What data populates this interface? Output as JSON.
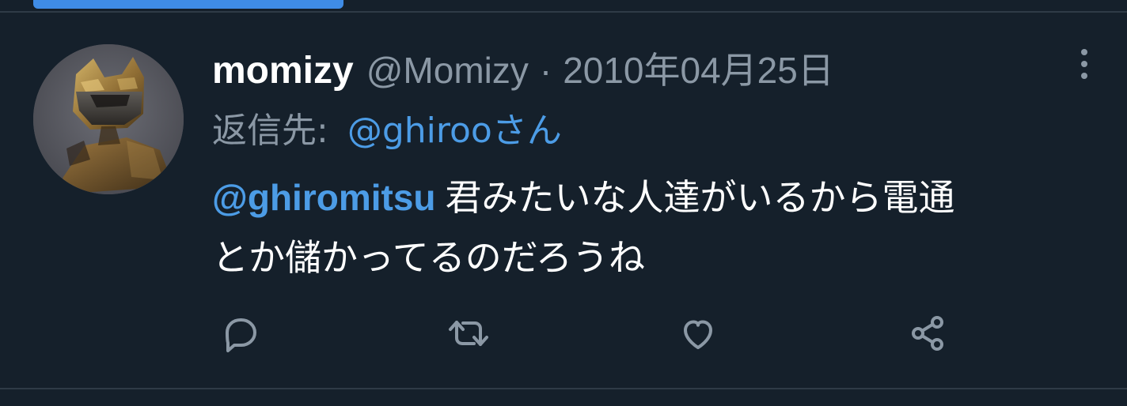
{
  "progress": {
    "value": 0.28,
    "color": "#3f8ce6"
  },
  "tweet": {
    "display_name": "momizy",
    "handle": "@Momizy",
    "separator": "·",
    "date": "2010年04月25日",
    "reply_prefix": "返信先:",
    "reply_user": "@ghirooさん",
    "mention": "@ghiromitsu",
    "text_line1": "君みたいな人達がいるから電通",
    "text_line2": "とか儲かってるのだろうね"
  },
  "icons": {
    "more": "more-vertical-icon",
    "reply": "reply-icon",
    "retweet": "retweet-icon",
    "like": "heart-icon",
    "share": "share-icon"
  },
  "colors": {
    "background": "#15202b",
    "primary_text": "#ffffff",
    "secondary_text": "#8b98a5",
    "link": "#4c9ce6",
    "divider": "#2f3b47"
  }
}
